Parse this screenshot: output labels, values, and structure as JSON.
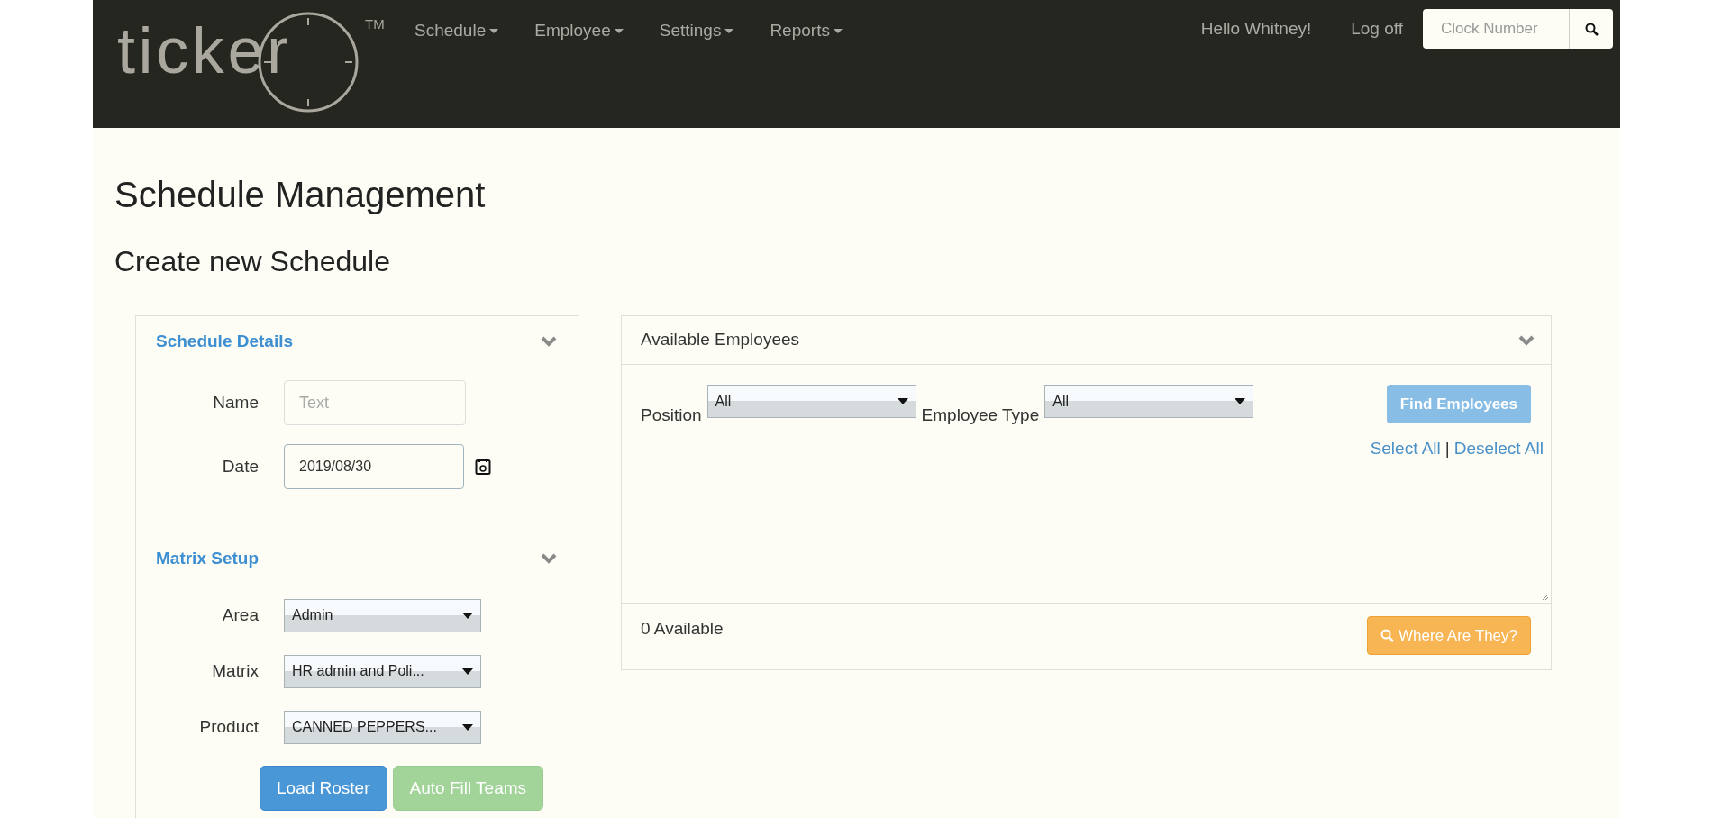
{
  "brand": {
    "name": "ticker",
    "trademark": "TM"
  },
  "nav": {
    "menus": [
      {
        "label": "Schedule"
      },
      {
        "label": "Employee"
      },
      {
        "label": "Settings"
      },
      {
        "label": "Reports"
      }
    ],
    "greeting": "Hello Whitney!",
    "logoff": "Log off",
    "search": {
      "placeholder": "Clock Number"
    }
  },
  "page": {
    "title": "Schedule Management",
    "subtitle": "Create new Schedule"
  },
  "schedule_panel": {
    "sections": [
      {
        "title": "Schedule Details",
        "fields": [
          {
            "kind": "text",
            "label": "Name",
            "placeholder": "Text"
          },
          {
            "kind": "date",
            "label": "Date",
            "value": "2019/08/30"
          }
        ]
      },
      {
        "title": "Matrix Setup",
        "fields": [
          {
            "kind": "select",
            "label": "Area",
            "value": "Admin"
          },
          {
            "kind": "select",
            "label": "Matrix",
            "value": "HR admin and Poli..."
          },
          {
            "kind": "select",
            "label": "Product",
            "value": "CANNED PEPPERS..."
          }
        ]
      }
    ],
    "buttons": [
      {
        "label": "Load Roster",
        "kind": "primary",
        "disabled": false
      },
      {
        "label": "Auto Fill Teams",
        "kind": "success",
        "disabled": true
      }
    ]
  },
  "employees_panel": {
    "title": "Available Employees",
    "filters": [
      {
        "label": "Position",
        "value": "All"
      },
      {
        "label": "Employee Type",
        "value": "All"
      }
    ],
    "find_button": {
      "label": "Find Employees",
      "disabled": true
    },
    "select_all": "Select All",
    "separator": "|",
    "deselect_all": "Deselect All",
    "count": "0 Available",
    "locate_button": {
      "label": "Where Are They?"
    }
  }
}
